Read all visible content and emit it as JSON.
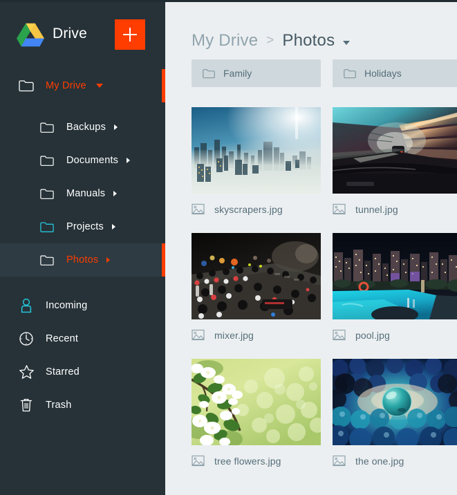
{
  "app": {
    "title": "Drive",
    "logo_icon": "google-drive-logo",
    "new_button": {
      "icon": "plus-icon",
      "label": "+"
    },
    "accent_color": "#ff3d00",
    "sidebar_bg": "#263238",
    "sidebar_selected_bg": "#2e3b42",
    "content_bg": "#eceff1",
    "teal_color": "#26c6da"
  },
  "sidebar": {
    "root": {
      "label": "My Drive",
      "icon": "folder-icon",
      "expanded": true,
      "accent": true,
      "caret": "caret-down"
    },
    "folders": [
      {
        "label": "Backups",
        "icon": "folder-icon",
        "icon_color": "#ffffff",
        "accent": false
      },
      {
        "label": "Documents",
        "icon": "folder-icon",
        "icon_color": "#ffffff",
        "accent": false
      },
      {
        "label": "Manuals",
        "icon": "folder-icon",
        "icon_color": "#ffffff",
        "accent": false
      },
      {
        "label": "Projects",
        "icon": "folder-icon",
        "icon_color": "#26c6da",
        "accent": false
      },
      {
        "label": "Photos",
        "icon": "folder-icon",
        "icon_color": "#ffffff",
        "accent": true,
        "selected": true
      }
    ],
    "sections": [
      {
        "label": "Incoming",
        "icon": "person-icon",
        "icon_color": "#26c6da"
      },
      {
        "label": "Recent",
        "icon": "clock-icon",
        "icon_color": "#ffffff"
      },
      {
        "label": "Starred",
        "icon": "star-icon",
        "icon_color": "#ffffff"
      },
      {
        "label": "Trash",
        "icon": "trash-icon",
        "icon_color": "#ffffff"
      }
    ]
  },
  "main": {
    "breadcrumb": {
      "parent": "My Drive",
      "separator": ">",
      "current": "Photos",
      "caret_icon": "chevron-down-icon"
    },
    "folders": [
      {
        "label": "Family",
        "icon": "folder-icon"
      },
      {
        "label": "Holidays",
        "icon": "folder-icon"
      }
    ],
    "files": [
      {
        "name": "skyscrapers.jpg",
        "icon": "image-file-icon",
        "thumb": "skyscrapers"
      },
      {
        "name": "tunnel.jpg",
        "icon": "image-file-icon",
        "thumb": "tunnel"
      },
      {
        "name": "mixer.jpg",
        "icon": "image-file-icon",
        "thumb": "mixer"
      },
      {
        "name": "pool.jpg",
        "icon": "image-file-icon",
        "thumb": "pool"
      },
      {
        "name": "tree flowers.jpg",
        "icon": "image-file-icon",
        "thumb": "flowers"
      },
      {
        "name": "the one.jpg",
        "icon": "image-file-icon",
        "thumb": "marbles"
      }
    ]
  }
}
